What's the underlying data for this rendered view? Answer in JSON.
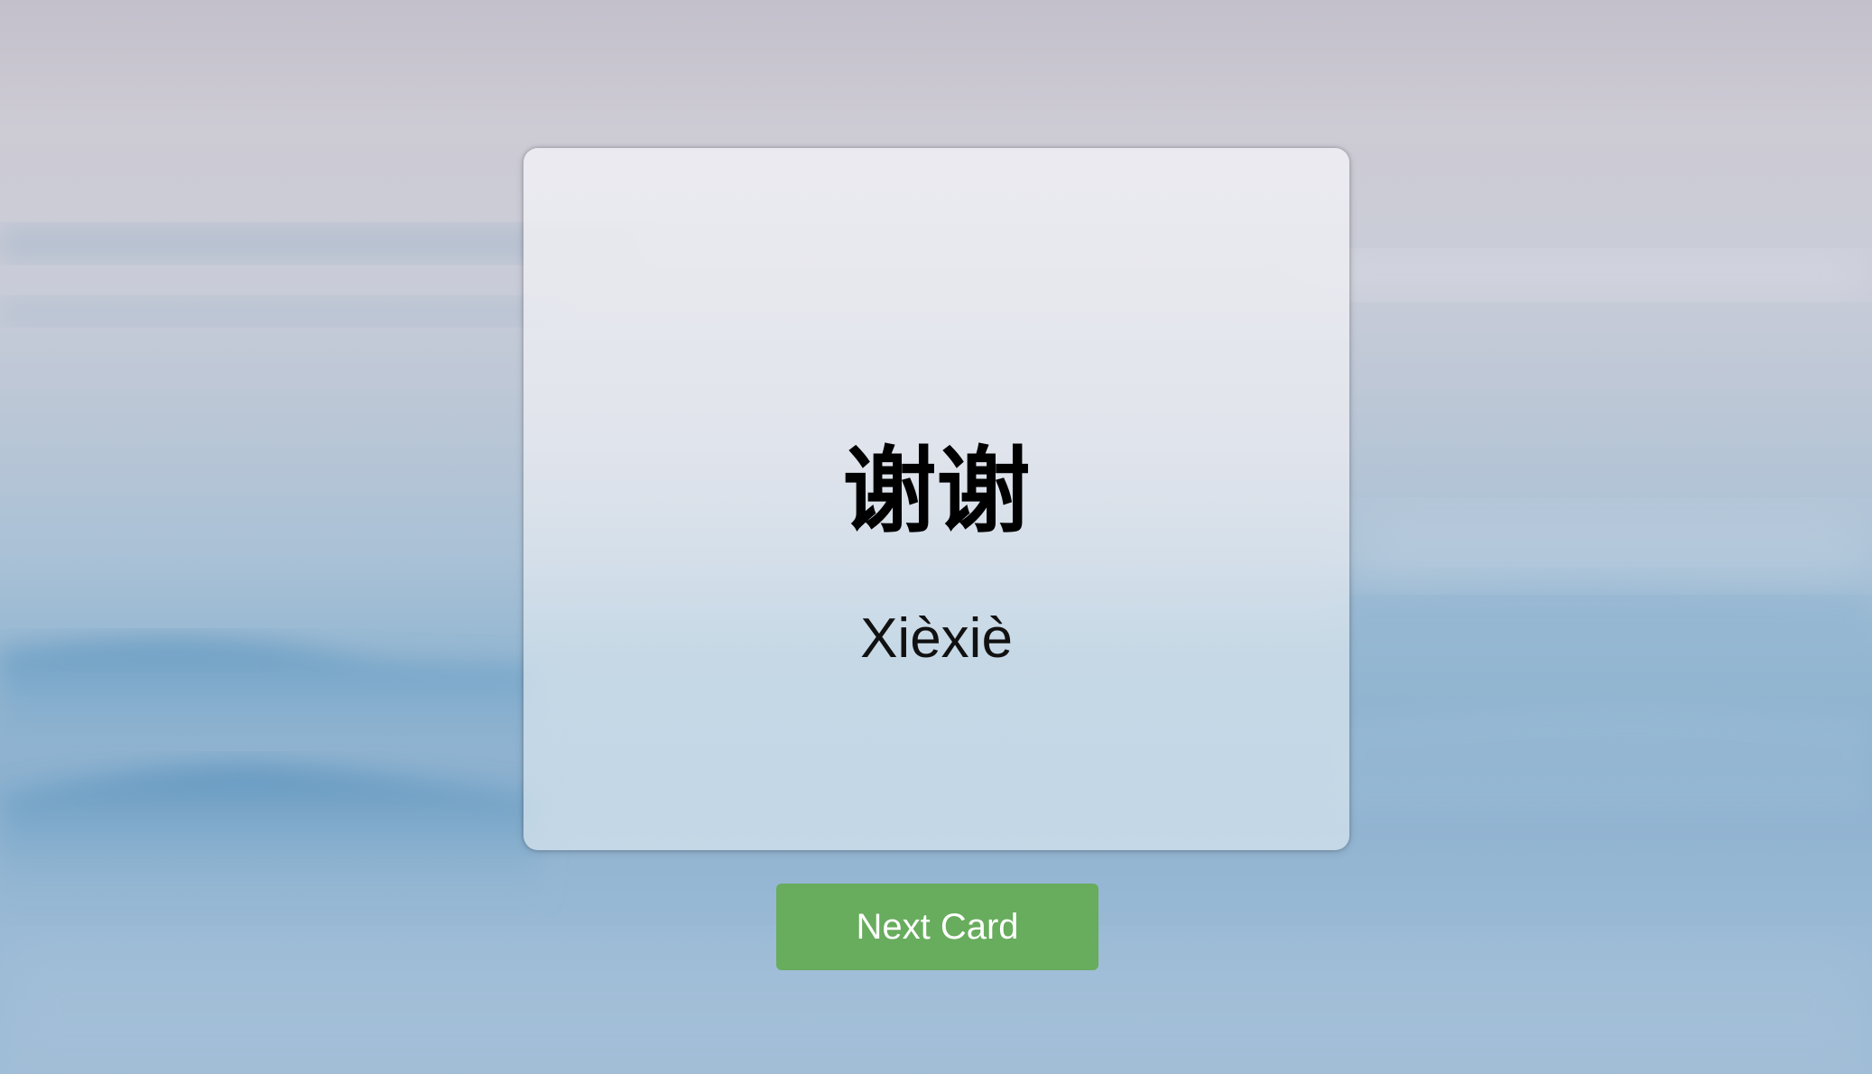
{
  "flashcard": {
    "character": "谢谢",
    "pinyin": "Xièxiè"
  },
  "controls": {
    "next_label": "Next Card"
  },
  "colors": {
    "button_bg": "#68ac5d",
    "button_text": "#ffffff",
    "card_bg": "#e8e9ef",
    "text": "#000000"
  }
}
